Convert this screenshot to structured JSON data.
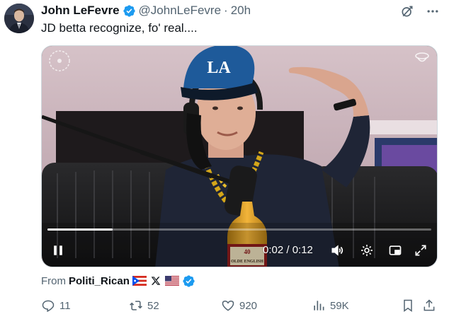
{
  "author": {
    "display_name": "John LeFevre",
    "handle": "@JohnLeFevre",
    "separator": "·",
    "time": "20h"
  },
  "tweet": {
    "text": "JD betta recognize, fo' real...."
  },
  "video": {
    "time_readout": "0:02 / 0:12",
    "progress": 0.17,
    "overlay_text": {
      "cap_logo": "LA",
      "bottle_brand": "OLDE ENGLISH",
      "bottle_size": "40"
    }
  },
  "attribution": {
    "from_label": "From",
    "source_name": "Politi_Rican"
  },
  "actions": {
    "replies": "11",
    "reposts": "52",
    "likes": "920",
    "views": "59K"
  },
  "icons": {
    "verified": "verified-badge-icon",
    "grok": "grok-icon",
    "more": "more-icon",
    "reply": "reply-icon",
    "repost": "repost-icon",
    "like": "heart-icon",
    "views": "views-icon",
    "bookmark": "bookmark-icon",
    "share": "share-icon",
    "pause": "pause-icon",
    "volume": "volume-icon",
    "settings": "settings-icon",
    "pip": "picture-in-picture-icon",
    "fullscreen": "fullscreen-icon"
  },
  "colors": {
    "verified_blue": "#1d9bf0",
    "text_primary": "#0f1419",
    "text_secondary": "#536471",
    "border": "#cfd9de",
    "cap_blue": "#1e5a9a"
  }
}
